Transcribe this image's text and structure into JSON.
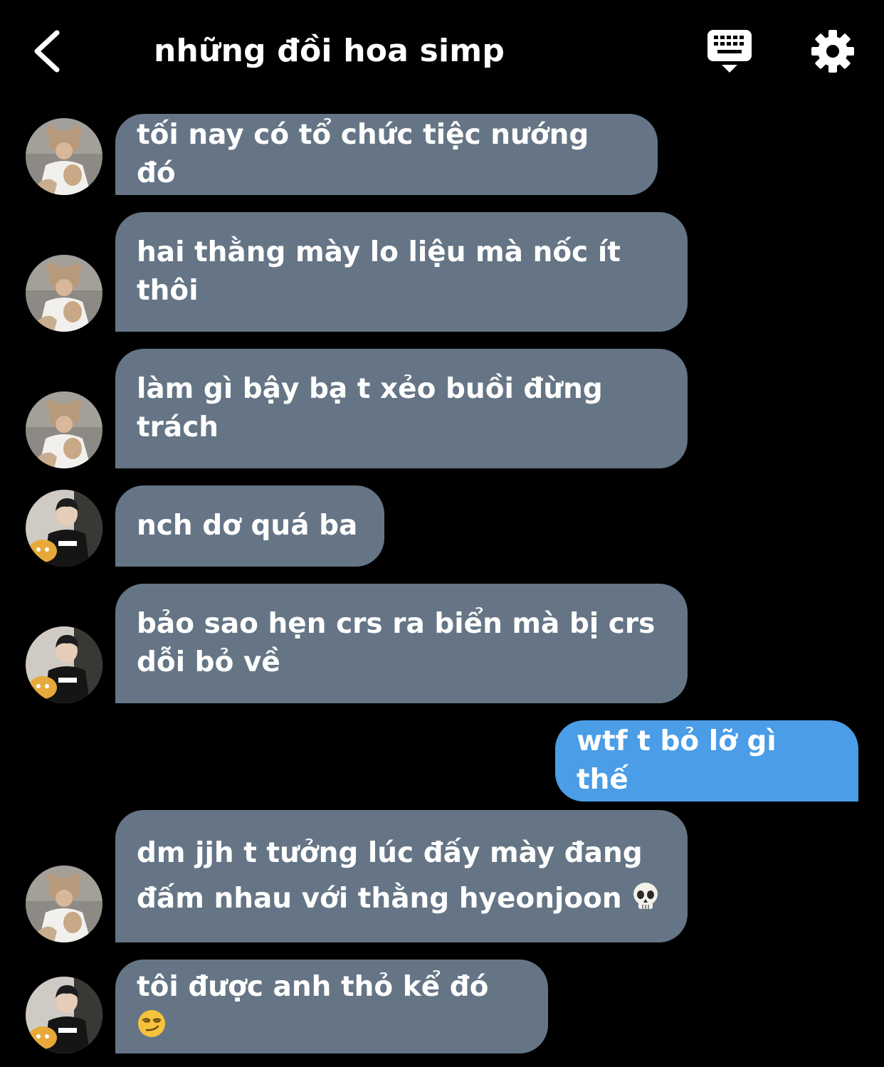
{
  "header": {
    "title": "những đồi hoa simp",
    "back_icon": "chevron-left-icon",
    "keyboard_icon": "keyboard-icon",
    "settings_icon": "gear-icon"
  },
  "colors": {
    "background": "#000000",
    "received_bubble": "#657585",
    "sent_bubble": "#4a9de6",
    "text": "#ffffff"
  },
  "messages": [
    {
      "sender": "bear-hat-user",
      "direction": "received",
      "text": "tối nay có tổ chức tiệc nướng đó"
    },
    {
      "sender": "bear-hat-user",
      "direction": "received",
      "text": "hai thằng mày lo liệu mà nốc ít thôi"
    },
    {
      "sender": "bear-hat-user",
      "direction": "received",
      "text": "làm gì bậy bạ t xẻo buồi đừng trách"
    },
    {
      "sender": "geng-user",
      "direction": "received",
      "text": "nch dơ quá ba"
    },
    {
      "sender": "geng-user",
      "direction": "received",
      "text": "bảo sao hẹn crs ra biển mà bị crs dỗi bỏ về"
    },
    {
      "sender": "me",
      "direction": "sent",
      "text": "wtf t bỏ lỡ gì thế"
    },
    {
      "sender": "bear-hat-user",
      "direction": "received",
      "text": "dm jjh t tưởng lúc đấy mày đang đấm nhau với thằng hyeonjoon",
      "emoji": "skull-emoji"
    },
    {
      "sender": "geng-user",
      "direction": "received",
      "text": "tôi được anh thỏ kể đó",
      "emoji": "smirk-emoji"
    }
  ]
}
